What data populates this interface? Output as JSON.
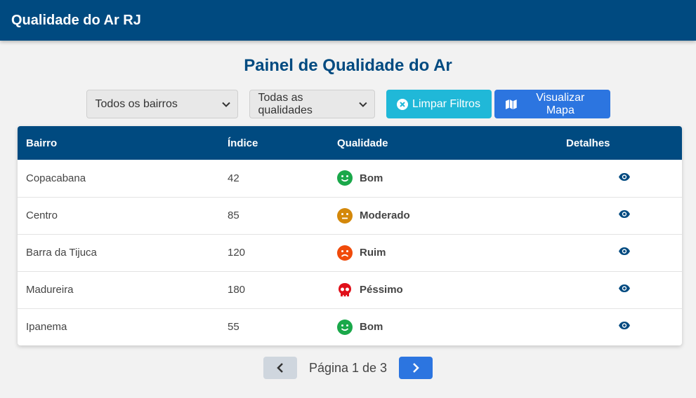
{
  "app": {
    "title": "Qualidade do Ar RJ"
  },
  "page": {
    "title": "Painel de Qualidade do Ar"
  },
  "filters": {
    "bairro_select": "Todos os bairros",
    "qualidade_select": "Todas as qualidades",
    "clear_label": "Limpar Filtros",
    "map_label": "Visualizar Mapa"
  },
  "table": {
    "headers": [
      "Bairro",
      "Índice",
      "Qualidade",
      "Detalhes"
    ],
    "rows": [
      {
        "bairro": "Copacabana",
        "indice": "42",
        "qualidade": "Bom",
        "icon": "smile-icon",
        "color": "#1aa84a"
      },
      {
        "bairro": "Centro",
        "indice": "85",
        "qualidade": "Moderado",
        "icon": "neutral-face-icon",
        "color": "#d4880a"
      },
      {
        "bairro": "Barra da Tijuca",
        "indice": "120",
        "qualidade": "Ruim",
        "icon": "frown-icon",
        "color": "#f04a0a"
      },
      {
        "bairro": "Madureira",
        "indice": "180",
        "qualidade": "Péssimo",
        "icon": "skull-icon",
        "color": "#e0101a"
      },
      {
        "bairro": "Ipanema",
        "indice": "55",
        "qualidade": "Bom",
        "icon": "smile-icon",
        "color": "#1aa84a"
      }
    ]
  },
  "pagination": {
    "text": "Página 1 de 3"
  },
  "colors": {
    "primary": "#004a80",
    "info": "#20b8d8",
    "accent": "#2c75e0"
  }
}
